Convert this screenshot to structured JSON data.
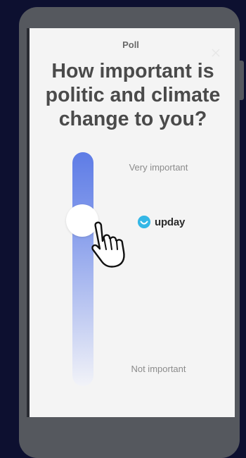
{
  "poll": {
    "label": "Poll",
    "question": "How important is politic and climate change to you?",
    "scale_top": "Very important",
    "scale_bottom": "Not important",
    "slider_level": 0.78
  },
  "brand": {
    "name": "upday",
    "logo_icon": "upday-smile-icon",
    "color": "#35b7e6"
  },
  "colors": {
    "accent": "#5e7ce6",
    "background": "#0d1030"
  },
  "cursor_icon": "hand-pointer-icon"
}
